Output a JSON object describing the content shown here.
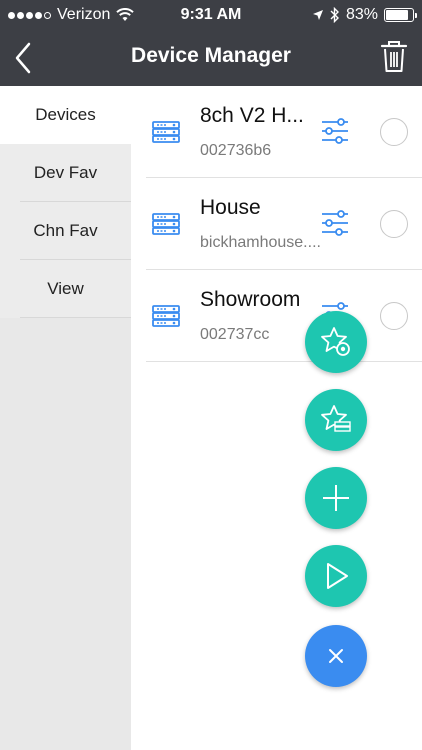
{
  "status_bar": {
    "carrier": "Verizon",
    "time": "9:31 AM",
    "battery": "83%",
    "battery_level": 0.83
  },
  "nav": {
    "title": "Device Manager"
  },
  "sidebar": {
    "items": [
      {
        "label": "Devices",
        "active": true
      },
      {
        "label": "Dev Fav",
        "active": false
      },
      {
        "label": "Chn Fav",
        "active": false
      },
      {
        "label": "View",
        "active": false
      }
    ]
  },
  "devices": [
    {
      "name": "8ch V2 H...",
      "sub": "002736b6"
    },
    {
      "name": "House",
      "sub": "bickhamhouse...."
    },
    {
      "name": "Showroom",
      "sub": "002737cc"
    }
  ],
  "colors": {
    "header": "#3d3f45",
    "accent_teal": "#1ec6b0",
    "accent_blue": "#3a8cf0",
    "icon_blue": "#3a8cf0"
  },
  "icons": {
    "fab1": "star-camera-icon",
    "fab2": "star-device-icon",
    "fab3": "plus-icon",
    "fab4": "play-icon",
    "fab5": "close-icon"
  }
}
